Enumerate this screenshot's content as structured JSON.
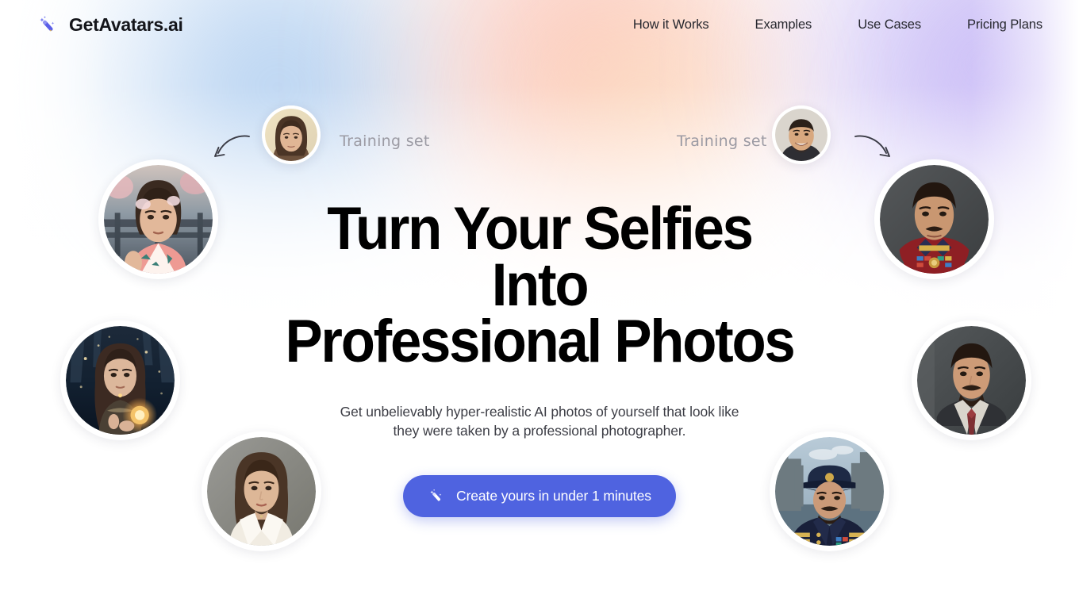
{
  "header": {
    "brand": {
      "name": "GetAvatars.ai",
      "icon": "magic-wand-icon"
    },
    "nav": [
      {
        "label": "How it Works"
      },
      {
        "label": "Examples"
      },
      {
        "label": "Use Cases"
      },
      {
        "label": "Pricing Plans"
      }
    ]
  },
  "hero": {
    "headline_line1": "Turn Your Selfies Into",
    "headline_line2": "Professional Photos",
    "subhead_line1": "Get unbelievably hyper-realistic AI photos of yourself that look",
    "subhead_line2": "like they were taken by a professional photographer.",
    "cta": {
      "label": "Create yours in under 1 minutes",
      "icon": "magic-wand-icon"
    }
  },
  "annotations": [
    {
      "label": "Training set",
      "side": "left"
    },
    {
      "label": "Training set",
      "side": "right"
    }
  ],
  "avatars": [
    {
      "name": "training-selfie-left",
      "style": "selfie-woman-warm",
      "size": "small"
    },
    {
      "name": "training-selfie-right",
      "style": "selfie-man-smiling",
      "size": "small"
    },
    {
      "name": "avatar-kimono-woman",
      "style": "kimono-woman",
      "size": "large"
    },
    {
      "name": "avatar-fantasy-woman",
      "style": "fantasy-woman-lantern",
      "size": "large"
    },
    {
      "name": "avatar-blazer-woman",
      "style": "blazer-woman-headshot",
      "size": "large"
    },
    {
      "name": "avatar-ceremonial-man",
      "style": "ceremonial-uniform-man",
      "size": "large"
    },
    {
      "name": "avatar-suit-man",
      "style": "business-suit-man",
      "size": "large"
    },
    {
      "name": "avatar-naval-man",
      "style": "naval-officer-man",
      "size": "large"
    }
  ],
  "colors": {
    "accent": "#4f63e0",
    "brand_icon": "#5b5fe8",
    "heading": "#000000",
    "body_text": "#3c3d45",
    "annotation_text": "#9b9aa3",
    "bg_blue": "#96bee b",
    "bg_peach": "#faafa0",
    "bg_purple": "#baaaf4"
  }
}
